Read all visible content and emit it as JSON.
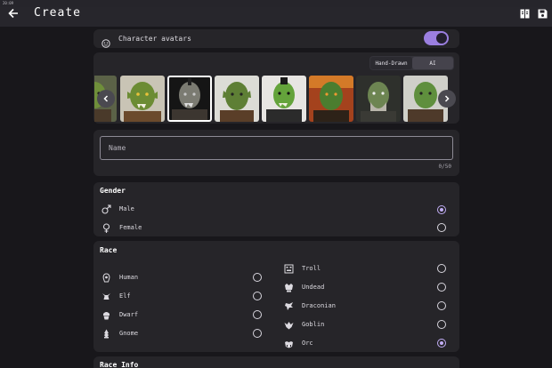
{
  "status": {
    "text": "20:09"
  },
  "appbar": {
    "title": "Create",
    "back_icon": "arrow-left-icon",
    "book_icon": "book-icon",
    "save_icon": "save-icon"
  },
  "avatars_toggle": {
    "label": "Character avatars",
    "enabled": true
  },
  "style_segment": {
    "options": [
      "Hand-Drawn",
      "AI"
    ],
    "selected": "AI"
  },
  "avatar_gallery": {
    "count_visible": 9,
    "selected_index": 2,
    "prev_icon": "chevron-left-icon",
    "next_icon": "chevron-right-icon"
  },
  "name": {
    "placeholder": "Name",
    "value": "",
    "counter": "0/50"
  },
  "gender": {
    "title": "Gender",
    "options": [
      {
        "label": "Male",
        "icon": "male-symbol-icon",
        "checked": true
      },
      {
        "label": "Female",
        "icon": "female-symbol-icon",
        "checked": false
      }
    ]
  },
  "race": {
    "title": "Race",
    "options_left": [
      {
        "label": "Human",
        "icon": "human-icon",
        "checked": false
      },
      {
        "label": "Elf",
        "icon": "elf-icon",
        "checked": false
      },
      {
        "label": "Dwarf",
        "icon": "dwarf-icon",
        "checked": false
      },
      {
        "label": "Gnome",
        "icon": "gnome-icon",
        "checked": false
      }
    ],
    "options_right": [
      {
        "label": "Troll",
        "icon": "troll-icon",
        "checked": false
      },
      {
        "label": "Undead",
        "icon": "undead-icon",
        "checked": false
      },
      {
        "label": "Draconian",
        "icon": "dragon-icon",
        "checked": false
      },
      {
        "label": "Goblin",
        "icon": "goblin-icon",
        "checked": false
      },
      {
        "label": "Orc",
        "icon": "orc-icon",
        "checked": true
      }
    ]
  },
  "race_info": {
    "title": "Race Info"
  },
  "colors": {
    "accent": "#9b7fe0",
    "radio_accent": "#c2aef5",
    "card": "#262529",
    "background": "#18171b"
  }
}
